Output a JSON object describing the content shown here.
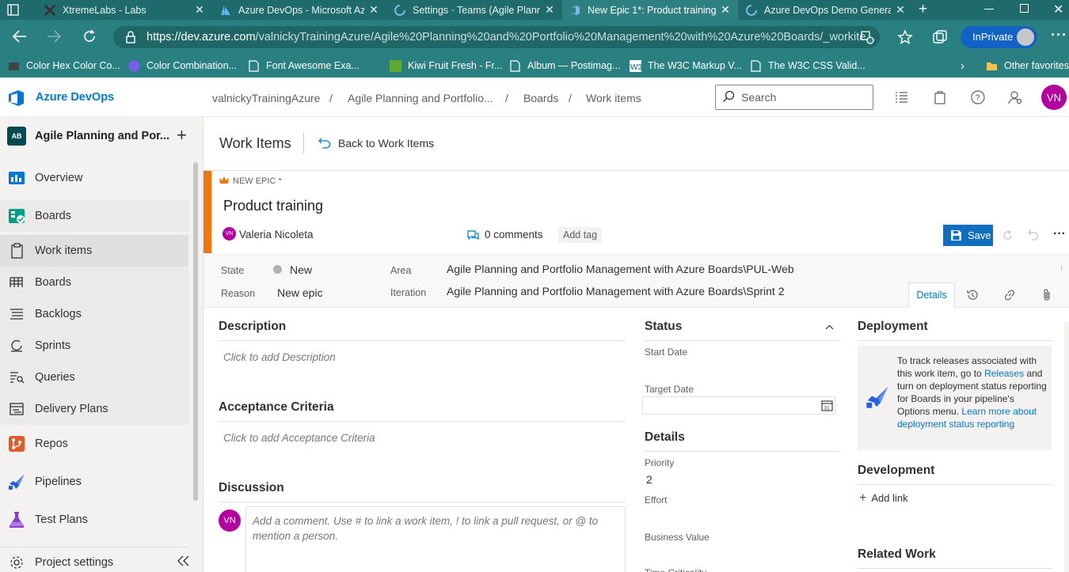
{
  "browser": {
    "tabs": [
      {
        "title": "XtremeLabs - Labs",
        "active": false
      },
      {
        "title": "Azure DevOps - Microsoft Azure",
        "active": false
      },
      {
        "title": "Settings · Teams (Agile Planning and Portfolio Management)",
        "active": false
      },
      {
        "title": "New Epic 1*: Product training",
        "active": true
      },
      {
        "title": "Azure DevOps Demo Generator",
        "active": false
      }
    ],
    "url": {
      "host": "https://dev.azure.com",
      "path": "/valnickyTrainingAzure/Agile%20Planning%20and%20Portfolio%20Management%20with%20Azure%20Boards/_workite..."
    },
    "inprivate_label": "InPrivate",
    "bookmarks": [
      "Color Hex Color Co...",
      "Color Combination...",
      "Font Awesome Exa...",
      "Kiwi Fruit Fresh - Fr...",
      "Album — Postimag...",
      "The W3C Markup V...",
      "The W3C CSS Valid..."
    ],
    "other_favorites": "Other favorites"
  },
  "header": {
    "product_name": "Azure DevOps",
    "breadcrumb": [
      "valnickyTrainingAzure",
      "Agile Planning and Portfolio...",
      "Boards",
      "Work items"
    ],
    "search_placeholder": "Search",
    "user_initials": "VN"
  },
  "sidebar": {
    "project_initials": "AB",
    "project_name": "Agile Planning and Por...",
    "items": [
      {
        "label": "Overview",
        "icon": "overview-icon"
      },
      {
        "label": "Boards",
        "icon": "boards-icon"
      },
      {
        "label": "Work items",
        "icon": "work-items-icon"
      },
      {
        "label": "Boards",
        "icon": "kanban-icon"
      },
      {
        "label": "Backlogs",
        "icon": "backlogs-icon"
      },
      {
        "label": "Sprints",
        "icon": "sprints-icon"
      },
      {
        "label": "Queries",
        "icon": "queries-icon"
      },
      {
        "label": "Delivery Plans",
        "icon": "delivery-plans-icon"
      },
      {
        "label": "Repos",
        "icon": "repos-icon"
      },
      {
        "label": "Pipelines",
        "icon": "pipelines-icon"
      },
      {
        "label": "Test Plans",
        "icon": "test-plans-icon"
      }
    ],
    "settings_label": "Project settings"
  },
  "page": {
    "title": "Work Items",
    "back_label": "Back to Work Items"
  },
  "work_item": {
    "type_label": "NEW EPIC *",
    "title": "Product training",
    "assignee_initials": "VN",
    "assignee": "Valeria Nicoleta",
    "comments": "0 comments",
    "add_tag": "Add tag",
    "save_label": "Save",
    "state_label": "State",
    "state_value": "New",
    "reason_label": "Reason",
    "reason_value": "New epic",
    "area_label": "Area",
    "area_value": "Agile Planning and Portfolio Management with Azure Boards\\PUL-Web",
    "iteration_label": "Iteration",
    "iteration_value": "Agile Planning and Portfolio Management with Azure Boards\\Sprint 2",
    "details_tab": "Details",
    "accent_color": "#f2760a",
    "save_color": "#106ebe"
  },
  "left_col": {
    "description_header": "Description",
    "description_placeholder": "Click to add Description",
    "acceptance_header": "Acceptance Criteria",
    "acceptance_placeholder": "Click to add Acceptance Criteria",
    "discussion_header": "Discussion",
    "comment_avatar": "VN",
    "comment_placeholder": "Add a comment. Use # to link a work item, ! to link a pull request, or @ to mention a person."
  },
  "middle_col": {
    "status_header": "Status",
    "start_date_label": "Start Date",
    "target_date_label": "Target Date",
    "details_header": "Details",
    "priority_label": "Priority",
    "priority_value": "2",
    "effort_label": "Effort",
    "business_value_label": "Business Value",
    "time_criticality_label": "Time Criticality"
  },
  "right_col": {
    "deployment_header": "Deployment",
    "deployment_text_1": "To track releases associated with this work item, go to",
    "deployment_link_1": "Releases",
    "deployment_text_2": "and turn on deployment status reporting for Boards in your pipeline's Options menu.",
    "deployment_link_2": "Learn more about deployment status reporting",
    "development_header": "Development",
    "add_link": "Add link",
    "related_header": "Related Work"
  }
}
